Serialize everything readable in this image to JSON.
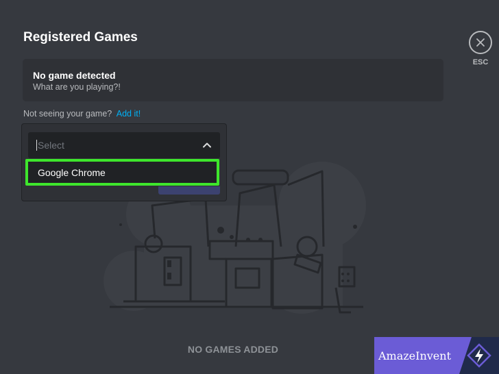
{
  "header": {
    "title": "Registered Games",
    "close_label": "ESC"
  },
  "detection": {
    "title": "No game detected",
    "subtitle": "What are you playing?!"
  },
  "missing": {
    "text": "Not seeing your game?",
    "link": "Add it!"
  },
  "dropdown": {
    "placeholder": "Select",
    "options": [
      "Google Chrome"
    ]
  },
  "empty_state": {
    "label": "NO GAMES ADDED"
  },
  "watermark": {
    "text": "AmazeInvent"
  },
  "colors": {
    "background": "#36393f",
    "panel": "#2f3136",
    "input": "#202225",
    "highlight": "#3ee62c",
    "link": "#00b0f4",
    "watermark": "#6b5cd6"
  },
  "icons": {
    "close": "close-icon",
    "chevron": "chevron-up-icon",
    "watermark": "lightning-icon"
  }
}
